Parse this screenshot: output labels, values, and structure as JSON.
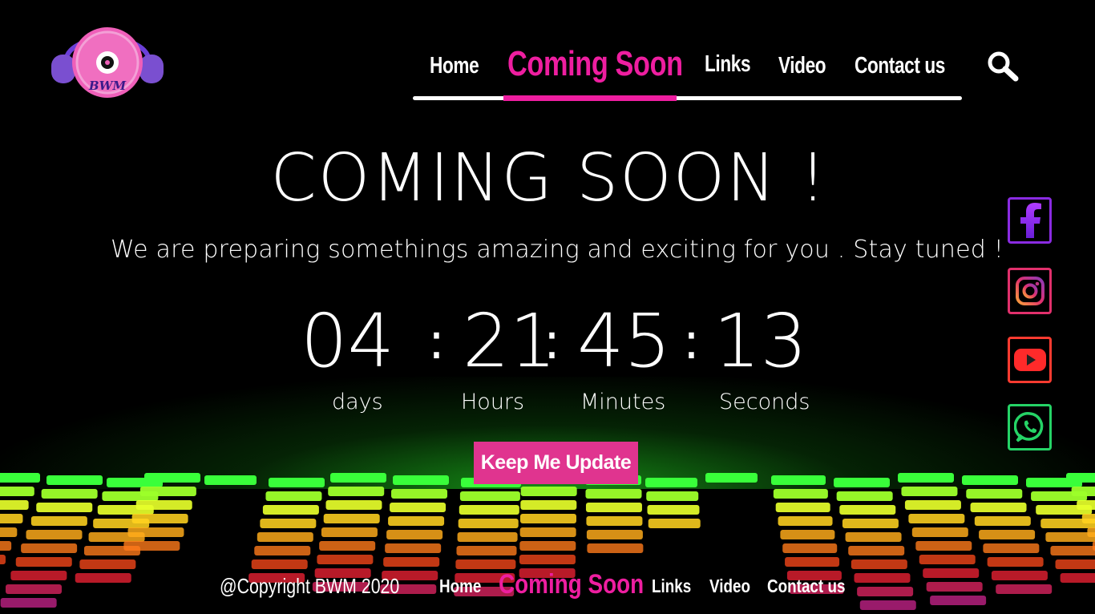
{
  "brand": {
    "logo_text": "BWM",
    "logo_icon": "headphones-disc-icon"
  },
  "nav": {
    "items": [
      {
        "label": "Home"
      },
      {
        "label": "Coming Soon",
        "active": true
      },
      {
        "label": "Links"
      },
      {
        "label": "Video"
      },
      {
        "label": "Contact us"
      }
    ],
    "search_icon": "search-icon"
  },
  "hero": {
    "title": "COMING SOON !",
    "subtitle": "We are preparing somethings amazing and exciting for you . Stay tuned !"
  },
  "countdown": {
    "days": "04",
    "hours": "21",
    "minutes": "45",
    "seconds": "13",
    "separator": ":",
    "labels": {
      "days": "days",
      "hours": "Hours",
      "minutes": "Minutes",
      "seconds": "Seconds"
    }
  },
  "cta": {
    "label": "Keep Me Update"
  },
  "social": [
    {
      "name": "facebook-icon",
      "color": "#8a2be2"
    },
    {
      "name": "instagram-icon",
      "color": "#e1306c"
    },
    {
      "name": "youtube-icon",
      "color": "#ff3b30"
    },
    {
      "name": "whatsapp-icon",
      "color": "#25d366"
    }
  ],
  "footer": {
    "copyright": "@Copyright BWM 2020",
    "items": [
      {
        "label": "Home"
      },
      {
        "label": "Coming Soon",
        "active": true
      },
      {
        "label": "Links"
      },
      {
        "label": "Video"
      },
      {
        "label": "Contact us"
      }
    ]
  },
  "colors": {
    "accent": "#ee1ea0",
    "background": "#000000",
    "button": "#e0348f"
  }
}
